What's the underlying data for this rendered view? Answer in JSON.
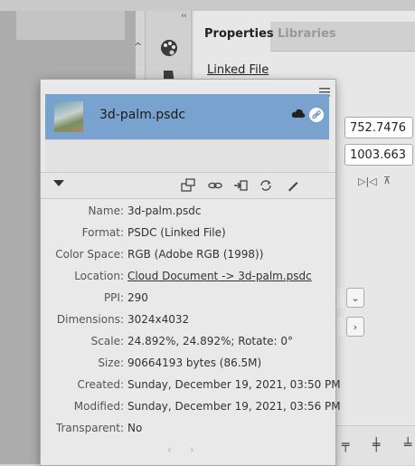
{
  "panel": {
    "tabs": [
      {
        "label": "Properties",
        "active": true
      },
      {
        "label": "Libraries",
        "active": false
      }
    ],
    "collapse_glyph": "‹‹",
    "section_title": "Linked File",
    "width_value": "752.7476",
    "height_value": "1003.663",
    "dropdown_glyph": "⌄",
    "next_glyph": "›"
  },
  "links_popup": {
    "file": {
      "name": "3d-palm.psdc",
      "selected": true,
      "status_icons": [
        "cloud-icon",
        "link-icon"
      ]
    },
    "toolbar_icons": [
      "relink-icon",
      "goto-link-icon",
      "embed-icon",
      "update-icon",
      "edit-original-icon"
    ],
    "info": [
      {
        "label": "Name:",
        "value": "3d-palm.psdc"
      },
      {
        "label": "Format:",
        "value": "PSDC (Linked File)"
      },
      {
        "label": "Color Space:",
        "value": "RGB (Adobe RGB (1998))"
      },
      {
        "label": "Location:",
        "value": "Cloud Document -> 3d-palm.psdc"
      },
      {
        "label": "PPI:",
        "value": "290"
      },
      {
        "label": "Dimensions:",
        "value": "3024x4032"
      },
      {
        "label": "Scale:",
        "value": "24.892%, 24.892%; Rotate: 0°"
      },
      {
        "label": "Size:",
        "value": "90664193 bytes (86.5M)"
      },
      {
        "label": "Created:",
        "value": "Sunday, December 19, 2021, 03:50 PM"
      },
      {
        "label": "Modified:",
        "value": "Sunday, December 19, 2021, 03:56 PM"
      },
      {
        "label": "Transparent:",
        "value": "No"
      }
    ],
    "pager": {
      "prev": "‹",
      "next": "›"
    }
  },
  "colors": {
    "selection": "#7aa2cf",
    "popup_bg": "#e9e9e9"
  }
}
